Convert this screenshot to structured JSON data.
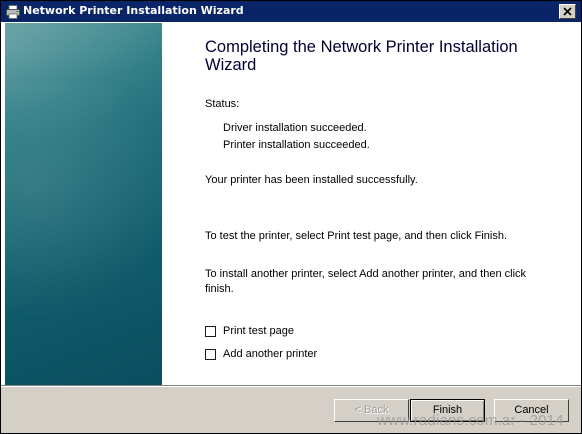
{
  "window": {
    "title": "Network Printer Installation Wizard"
  },
  "main": {
    "heading": "Completing the Network Printer Installation Wizard",
    "status_label": "Status:",
    "status_lines": [
      "Driver installation succeeded.",
      "Printer installation succeeded."
    ],
    "installed_message": "Your printer has been installed successfully.",
    "test_instruction": "To test the printer, select Print test page, and then click Finish.",
    "another_instruction": "To install another printer, select Add another printer, and then click finish.",
    "options": [
      {
        "label": "Print test page",
        "checked": false
      },
      {
        "label": "Add another printer",
        "checked": false
      }
    ]
  },
  "buttons": {
    "back": "< Back",
    "finish": "Finish",
    "cancel": "Cancel"
  },
  "watermark": "www.radians.com.ar - 2014",
  "icons": {
    "title": "printer-icon",
    "close": "close-icon"
  },
  "colors": {
    "titlebar": "#0a2468",
    "side_panel": "#1c6a76",
    "heading": "#000033"
  }
}
